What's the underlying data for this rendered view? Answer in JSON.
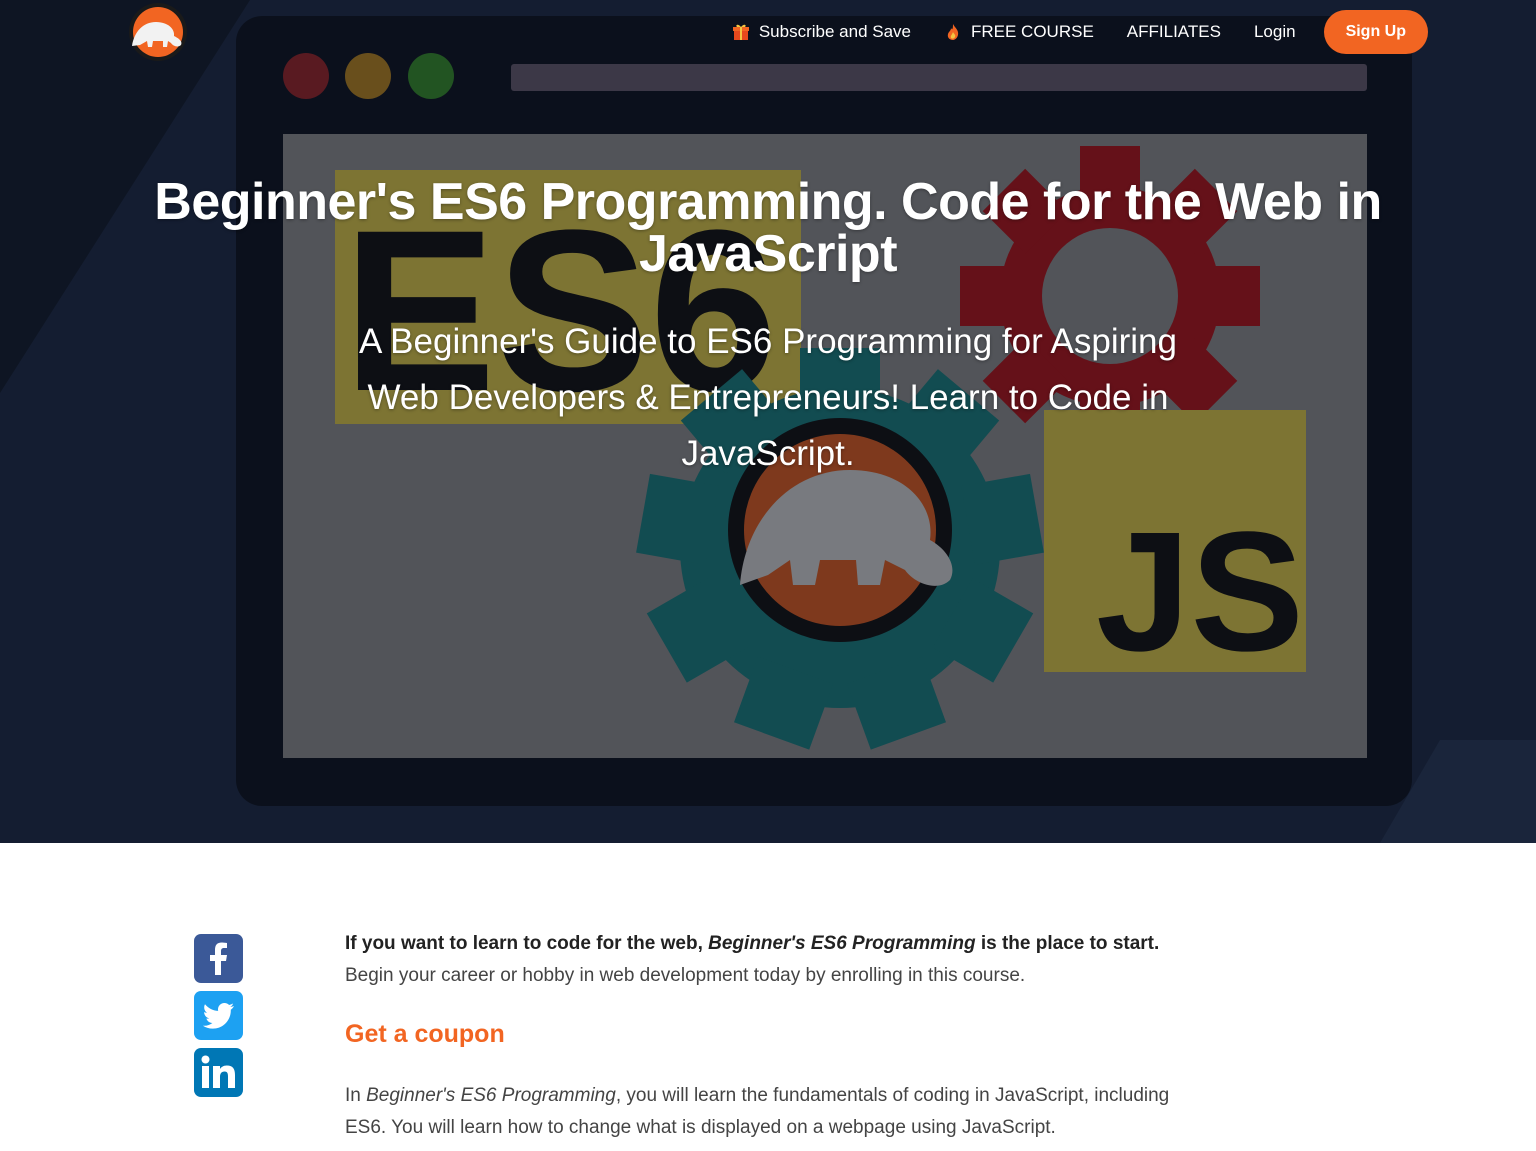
{
  "nav": {
    "logo_icon": "mammoth-logo-icon",
    "links": [
      {
        "label": "Subscribe and Save",
        "icon": "gift-icon"
      },
      {
        "label": "FREE COURSE",
        "icon": "fire-icon"
      },
      {
        "label": "AFFILIATES"
      },
      {
        "label": "Login"
      }
    ],
    "signup_label": "Sign Up"
  },
  "hero": {
    "title": "Beginner's ES6 Programming. Code for the Web in JavaScript",
    "subtitle": "A Beginner's Guide to ES6 Programming for Aspiring Web Developers & Entrepreneurs! Learn to Code in JavaScript.",
    "art_labels": {
      "es6": "ES6",
      "js": "JS"
    }
  },
  "share": [
    {
      "icon": "facebook-icon",
      "color": "#3b5998"
    },
    {
      "icon": "twitter-icon",
      "color": "#1da1f2"
    },
    {
      "icon": "linkedin-icon",
      "color": "#0077b5"
    }
  ],
  "content": {
    "intro_bold_before": "If you want to learn to code for the web, ",
    "intro_bold_em": "Beginner's ES6 Programming",
    "intro_bold_after": " is the place to start.",
    "intro_text": "Begin your career or hobby in web development today by enrolling in this course.",
    "coupon_label": "Get a coupon",
    "para_before": "In ",
    "para_em": "Beginner's ES6 Programming",
    "para_after": ", you will learn the fundamentals of coding in JavaScript, including ES6. You will learn how to change what is displayed on a webpage using JavaScript."
  },
  "colors": {
    "accent": "#f26522",
    "hero_bg": "#131c2e",
    "es6_yellow": "#f0db4f",
    "gear_red": "#c0141a",
    "gear_teal": "#1a8a8a"
  }
}
